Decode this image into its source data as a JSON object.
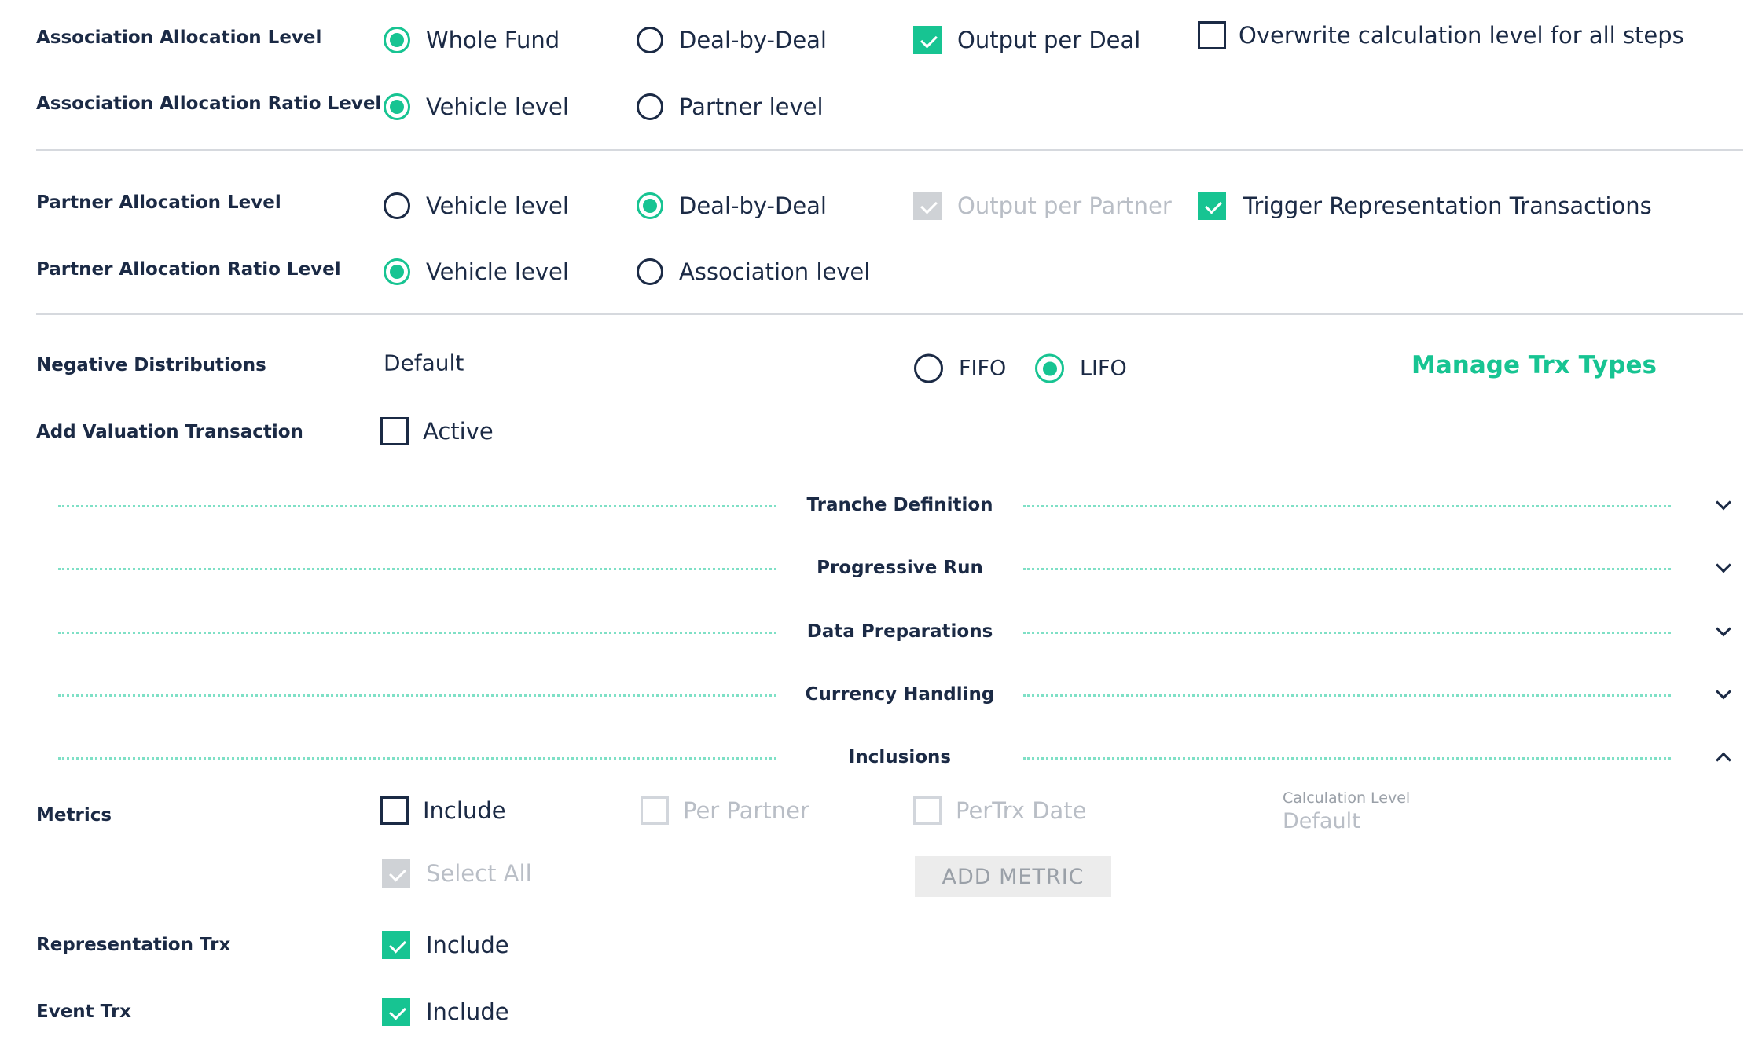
{
  "association": {
    "alloc_level": {
      "label": "Association Allocation Level",
      "opt_whole_fund": "Whole Fund",
      "opt_deal_by_deal": "Deal-by-Deal",
      "output_per_deal": "Output per Deal",
      "overwrite": "Overwrite calculation level for all steps",
      "selected": "Whole Fund",
      "output_per_deal_checked": true,
      "overwrite_checked": false
    },
    "ratio_level": {
      "label": "Association Allocation Ratio Level",
      "opt_vehicle": "Vehicle level",
      "opt_partner": "Partner level",
      "selected": "Vehicle level"
    }
  },
  "partner": {
    "alloc_level": {
      "label": "Partner Allocation Level",
      "opt_vehicle": "Vehicle level",
      "opt_deal_by_deal": "Deal-by-Deal",
      "output_per_partner": "Output per Partner",
      "trigger_repr": "Trigger Representation Transactions",
      "selected": "Deal-by-Deal",
      "output_per_partner_checked": true,
      "output_per_partner_disabled": true,
      "trigger_repr_checked": true
    },
    "ratio_level": {
      "label": "Partner Allocation Ratio Level",
      "opt_vehicle": "Vehicle level",
      "opt_association": "Association level",
      "selected": "Vehicle level"
    }
  },
  "negative_distributions": {
    "label": "Negative Distributions",
    "value": "Default",
    "opt_fifo": "FIFO",
    "opt_lifo": "LIFO",
    "selected": "LIFO",
    "manage_link": "Manage Trx Types"
  },
  "valuation": {
    "label": "Add Valuation Transaction",
    "active_label": "Active",
    "active_checked": false
  },
  "sections": [
    {
      "title": "Tranche Definition",
      "expanded": false
    },
    {
      "title": "Progressive Run",
      "expanded": false
    },
    {
      "title": "Data Preparations",
      "expanded": false
    },
    {
      "title": "Currency Handling",
      "expanded": false
    },
    {
      "title": "Inclusions",
      "expanded": true
    }
  ],
  "inclusions": {
    "metrics": {
      "label": "Metrics",
      "include": "Include",
      "per_partner": "Per Partner",
      "per_trx_date": "PerTrx Date",
      "calc_level_label": "Calculation Level",
      "calc_level_value": "Default",
      "select_all": "Select All",
      "add_metric": "ADD METRIC"
    },
    "representation": {
      "label": "Representation Trx",
      "include": "Include",
      "checked": true
    },
    "event": {
      "label": "Event Trx",
      "include": "Include",
      "checked": true
    }
  },
  "colors": {
    "accent": "#17c492",
    "text": "#1b2a45",
    "disabled": "#b9bec6"
  }
}
